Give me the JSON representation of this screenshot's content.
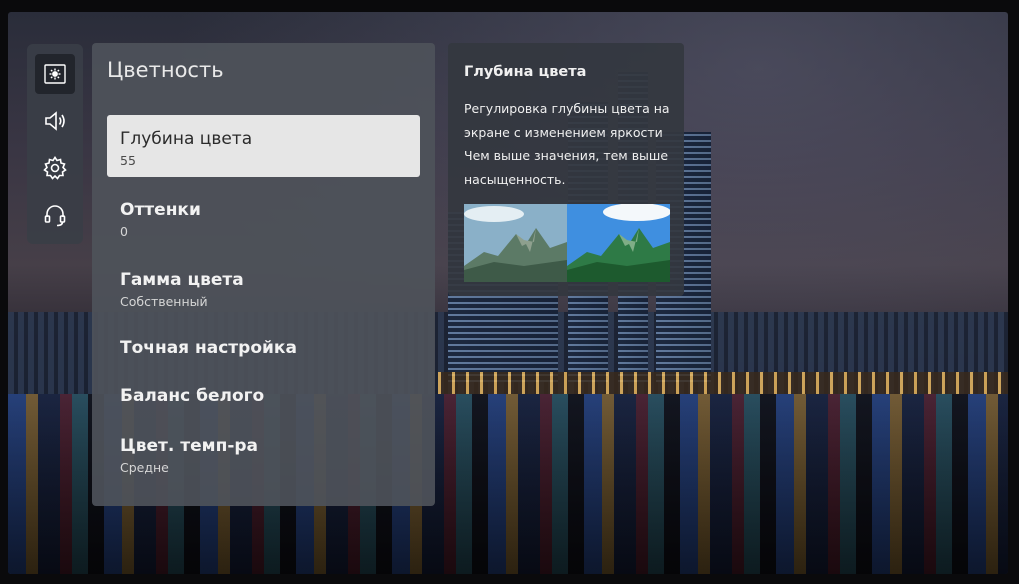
{
  "sidebar": {
    "icons": [
      {
        "name": "picture-icon",
        "active": true
      },
      {
        "name": "sound-icon",
        "active": false
      },
      {
        "name": "settings-gear-icon",
        "active": false
      },
      {
        "name": "support-headset-icon",
        "active": false
      }
    ]
  },
  "menu": {
    "title": "Цветность",
    "items": [
      {
        "label": "Глубина цвета",
        "value": "55",
        "selected": true
      },
      {
        "label": "Оттенки",
        "value": "0",
        "selected": false
      },
      {
        "label": "Гамма цвета",
        "value": "Собственный",
        "selected": false
      },
      {
        "label": "Точная настройка",
        "value": "",
        "selected": false
      },
      {
        "label": "Баланс белого",
        "value": "",
        "selected": false
      },
      {
        "label": "Цвет. темп-ра",
        "value": "Средне",
        "selected": false
      }
    ]
  },
  "info": {
    "title": "Глубина цвета",
    "text": "Регулировка глубины цвета на экране с изменением яркости Чем выше значения, тем выше насыщенность.",
    "preview_before": "low-saturation-mountain-preview",
    "preview_after": "high-saturation-mountain-preview"
  },
  "colors": {
    "menu_bg": "#4e525a",
    "selected_bg": "#e6e6e6",
    "info_bg": "#343840"
  }
}
